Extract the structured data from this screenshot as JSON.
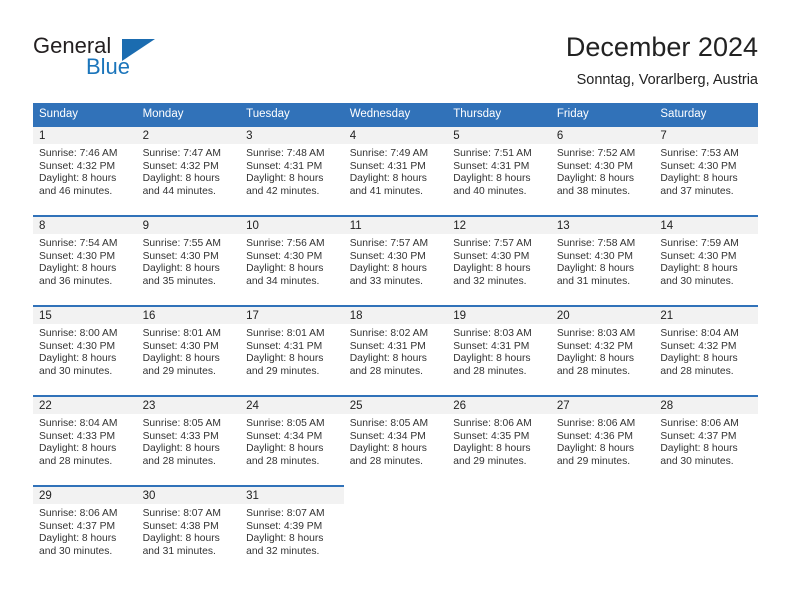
{
  "brand": {
    "name_part1": "General",
    "name_part2": "Blue",
    "triangle_color": "#1b6cb0",
    "blue_color": "#1b75bb"
  },
  "header": {
    "title": "December 2024",
    "subtitle": "Sonntag, Vorarlberg, Austria"
  },
  "theme": {
    "header_blue": "#3172b9",
    "daynum_gray": "#f2f2f2"
  },
  "weekday_headers": [
    "Sunday",
    "Monday",
    "Tuesday",
    "Wednesday",
    "Thursday",
    "Friday",
    "Saturday"
  ],
  "weeks": [
    [
      {
        "day": "1",
        "sunrise": "Sunrise: 7:46 AM",
        "sunset": "Sunset: 4:32 PM",
        "daylight_line1": "Daylight: 8 hours",
        "daylight_line2": "and 46 minutes."
      },
      {
        "day": "2",
        "sunrise": "Sunrise: 7:47 AM",
        "sunset": "Sunset: 4:32 PM",
        "daylight_line1": "Daylight: 8 hours",
        "daylight_line2": "and 44 minutes."
      },
      {
        "day": "3",
        "sunrise": "Sunrise: 7:48 AM",
        "sunset": "Sunset: 4:31 PM",
        "daylight_line1": "Daylight: 8 hours",
        "daylight_line2": "and 42 minutes."
      },
      {
        "day": "4",
        "sunrise": "Sunrise: 7:49 AM",
        "sunset": "Sunset: 4:31 PM",
        "daylight_line1": "Daylight: 8 hours",
        "daylight_line2": "and 41 minutes."
      },
      {
        "day": "5",
        "sunrise": "Sunrise: 7:51 AM",
        "sunset": "Sunset: 4:31 PM",
        "daylight_line1": "Daylight: 8 hours",
        "daylight_line2": "and 40 minutes."
      },
      {
        "day": "6",
        "sunrise": "Sunrise: 7:52 AM",
        "sunset": "Sunset: 4:30 PM",
        "daylight_line1": "Daylight: 8 hours",
        "daylight_line2": "and 38 minutes."
      },
      {
        "day": "7",
        "sunrise": "Sunrise: 7:53 AM",
        "sunset": "Sunset: 4:30 PM",
        "daylight_line1": "Daylight: 8 hours",
        "daylight_line2": "and 37 minutes."
      }
    ],
    [
      {
        "day": "8",
        "sunrise": "Sunrise: 7:54 AM",
        "sunset": "Sunset: 4:30 PM",
        "daylight_line1": "Daylight: 8 hours",
        "daylight_line2": "and 36 minutes."
      },
      {
        "day": "9",
        "sunrise": "Sunrise: 7:55 AM",
        "sunset": "Sunset: 4:30 PM",
        "daylight_line1": "Daylight: 8 hours",
        "daylight_line2": "and 35 minutes."
      },
      {
        "day": "10",
        "sunrise": "Sunrise: 7:56 AM",
        "sunset": "Sunset: 4:30 PM",
        "daylight_line1": "Daylight: 8 hours",
        "daylight_line2": "and 34 minutes."
      },
      {
        "day": "11",
        "sunrise": "Sunrise: 7:57 AM",
        "sunset": "Sunset: 4:30 PM",
        "daylight_line1": "Daylight: 8 hours",
        "daylight_line2": "and 33 minutes."
      },
      {
        "day": "12",
        "sunrise": "Sunrise: 7:57 AM",
        "sunset": "Sunset: 4:30 PM",
        "daylight_line1": "Daylight: 8 hours",
        "daylight_line2": "and 32 minutes."
      },
      {
        "day": "13",
        "sunrise": "Sunrise: 7:58 AM",
        "sunset": "Sunset: 4:30 PM",
        "daylight_line1": "Daylight: 8 hours",
        "daylight_line2": "and 31 minutes."
      },
      {
        "day": "14",
        "sunrise": "Sunrise: 7:59 AM",
        "sunset": "Sunset: 4:30 PM",
        "daylight_line1": "Daylight: 8 hours",
        "daylight_line2": "and 30 minutes."
      }
    ],
    [
      {
        "day": "15",
        "sunrise": "Sunrise: 8:00 AM",
        "sunset": "Sunset: 4:30 PM",
        "daylight_line1": "Daylight: 8 hours",
        "daylight_line2": "and 30 minutes."
      },
      {
        "day": "16",
        "sunrise": "Sunrise: 8:01 AM",
        "sunset": "Sunset: 4:30 PM",
        "daylight_line1": "Daylight: 8 hours",
        "daylight_line2": "and 29 minutes."
      },
      {
        "day": "17",
        "sunrise": "Sunrise: 8:01 AM",
        "sunset": "Sunset: 4:31 PM",
        "daylight_line1": "Daylight: 8 hours",
        "daylight_line2": "and 29 minutes."
      },
      {
        "day": "18",
        "sunrise": "Sunrise: 8:02 AM",
        "sunset": "Sunset: 4:31 PM",
        "daylight_line1": "Daylight: 8 hours",
        "daylight_line2": "and 28 minutes."
      },
      {
        "day": "19",
        "sunrise": "Sunrise: 8:03 AM",
        "sunset": "Sunset: 4:31 PM",
        "daylight_line1": "Daylight: 8 hours",
        "daylight_line2": "and 28 minutes."
      },
      {
        "day": "20",
        "sunrise": "Sunrise: 8:03 AM",
        "sunset": "Sunset: 4:32 PM",
        "daylight_line1": "Daylight: 8 hours",
        "daylight_line2": "and 28 minutes."
      },
      {
        "day": "21",
        "sunrise": "Sunrise: 8:04 AM",
        "sunset": "Sunset: 4:32 PM",
        "daylight_line1": "Daylight: 8 hours",
        "daylight_line2": "and 28 minutes."
      }
    ],
    [
      {
        "day": "22",
        "sunrise": "Sunrise: 8:04 AM",
        "sunset": "Sunset: 4:33 PM",
        "daylight_line1": "Daylight: 8 hours",
        "daylight_line2": "and 28 minutes."
      },
      {
        "day": "23",
        "sunrise": "Sunrise: 8:05 AM",
        "sunset": "Sunset: 4:33 PM",
        "daylight_line1": "Daylight: 8 hours",
        "daylight_line2": "and 28 minutes."
      },
      {
        "day": "24",
        "sunrise": "Sunrise: 8:05 AM",
        "sunset": "Sunset: 4:34 PM",
        "daylight_line1": "Daylight: 8 hours",
        "daylight_line2": "and 28 minutes."
      },
      {
        "day": "25",
        "sunrise": "Sunrise: 8:05 AM",
        "sunset": "Sunset: 4:34 PM",
        "daylight_line1": "Daylight: 8 hours",
        "daylight_line2": "and 28 minutes."
      },
      {
        "day": "26",
        "sunrise": "Sunrise: 8:06 AM",
        "sunset": "Sunset: 4:35 PM",
        "daylight_line1": "Daylight: 8 hours",
        "daylight_line2": "and 29 minutes."
      },
      {
        "day": "27",
        "sunrise": "Sunrise: 8:06 AM",
        "sunset": "Sunset: 4:36 PM",
        "daylight_line1": "Daylight: 8 hours",
        "daylight_line2": "and 29 minutes."
      },
      {
        "day": "28",
        "sunrise": "Sunrise: 8:06 AM",
        "sunset": "Sunset: 4:37 PM",
        "daylight_line1": "Daylight: 8 hours",
        "daylight_line2": "and 30 minutes."
      }
    ],
    [
      {
        "day": "29",
        "sunrise": "Sunrise: 8:06 AM",
        "sunset": "Sunset: 4:37 PM",
        "daylight_line1": "Daylight: 8 hours",
        "daylight_line2": "and 30 minutes."
      },
      {
        "day": "30",
        "sunrise": "Sunrise: 8:07 AM",
        "sunset": "Sunset: 4:38 PM",
        "daylight_line1": "Daylight: 8 hours",
        "daylight_line2": "and 31 minutes."
      },
      {
        "day": "31",
        "sunrise": "Sunrise: 8:07 AM",
        "sunset": "Sunset: 4:39 PM",
        "daylight_line1": "Daylight: 8 hours",
        "daylight_line2": "and 32 minutes."
      },
      {
        "day": "",
        "sunrise": "",
        "sunset": "",
        "daylight_line1": "",
        "daylight_line2": ""
      },
      {
        "day": "",
        "sunrise": "",
        "sunset": "",
        "daylight_line1": "",
        "daylight_line2": ""
      },
      {
        "day": "",
        "sunrise": "",
        "sunset": "",
        "daylight_line1": "",
        "daylight_line2": ""
      },
      {
        "day": "",
        "sunrise": "",
        "sunset": "",
        "daylight_line1": "",
        "daylight_line2": ""
      }
    ]
  ]
}
